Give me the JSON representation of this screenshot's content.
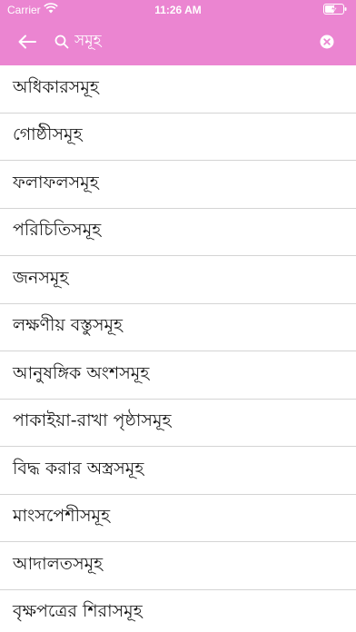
{
  "status_bar": {
    "carrier": "Carrier",
    "time": "11:26 AM"
  },
  "colors": {
    "header": "#eb85d1",
    "icon": "#ffffff",
    "divider": "#d4d4d4"
  },
  "toolbar": {
    "back_icon": "arrow-left-icon",
    "search_icon": "search-icon",
    "search_value": "সমূহ",
    "clear_icon": "clear-icon"
  },
  "results": [
    "অধিকারসমূহ",
    "গোষ্ঠীসমূহ",
    "ফলাফলসমূহ",
    "পরিচিতিসমূহ",
    "জনসমূহ",
    "লক্ষণীয় বস্তুসমূহ",
    "আনুষঙ্গিক অংশসমূহ",
    "পাকাইয়া-রাখা পৃষ্ঠাসমূহ",
    "বিদ্ধ করার অস্ত্রসমূহ",
    "মাংসপেশীসমূহ",
    "আদালতসমূহ",
    "বৃক্ষপত্রের শিরাসমূহ"
  ]
}
